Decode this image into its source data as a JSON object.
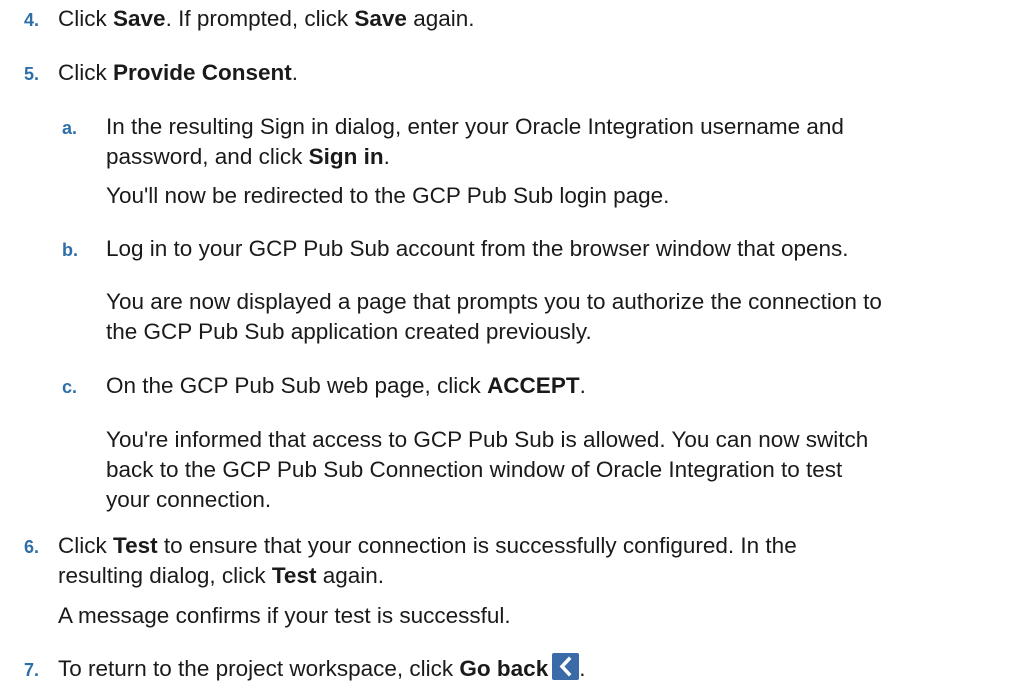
{
  "steps": {
    "s4": {
      "num": "4.",
      "pre": "Click ",
      "b1": "Save",
      "mid": ". If prompted, click ",
      "b2": "Save",
      "post": " again."
    },
    "s5": {
      "num": "5.",
      "pre": "Click ",
      "b1": "Provide Consent",
      "post": ".",
      "a": {
        "num": "a.",
        "line1": "In the resulting Sign in dialog, enter your Oracle Integration username and",
        "line2_pre": "password, and click ",
        "line2_b": "Sign in",
        "line2_post": ".",
        "note": "You'll now be redirected to the GCP Pub Sub login page."
      },
      "b": {
        "num": "b.",
        "line1": "Log in to your GCP Pub Sub account from the browser window that opens.",
        "note_line1": "You are now displayed a page that prompts you to authorize the connection to",
        "note_line2": "the GCP Pub Sub application created previously."
      },
      "c": {
        "num": "c.",
        "line1_pre": "On the GCP Pub Sub web page, click ",
        "line1_b": "ACCEPT",
        "line1_post": ".",
        "note_line1": "You're informed that access to GCP Pub Sub is allowed. You can now switch",
        "note_line2": "back to the GCP Pub Sub Connection window of Oracle Integration to test",
        "note_line3": "your connection."
      }
    },
    "s6": {
      "num": "6.",
      "line1_pre": "Click ",
      "line1_b": "Test",
      "line1_post": " to ensure that your connection is successfully configured. In the",
      "line2_pre": "resulting dialog, click ",
      "line2_b": "Test",
      "line2_post": " again.",
      "note": "A message confirms if your test is successful."
    },
    "s7": {
      "num": "7.",
      "pre": "To return to the project workspace, click ",
      "b1": "Go back",
      "post": ".",
      "icon": "chevron-left-icon"
    }
  },
  "colors": {
    "step_number": "#2f6fa7",
    "text": "#1a1a1a",
    "icon_bg": "#3b6aa8"
  }
}
